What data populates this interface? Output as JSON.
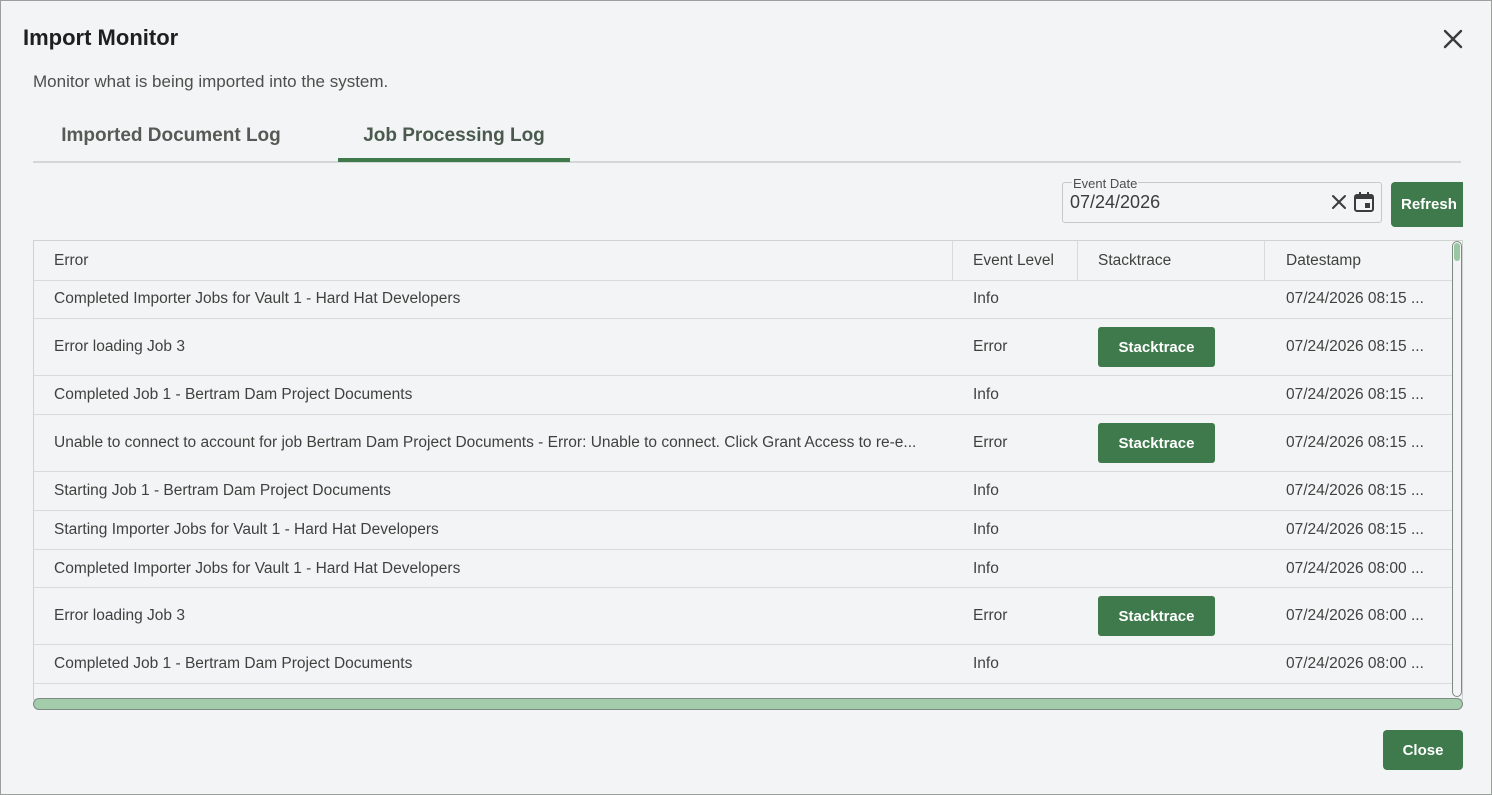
{
  "dialog": {
    "title": "Import Monitor",
    "subtitle": "Monitor what is being imported into the system.",
    "close_icon": "close-icon"
  },
  "tabs": [
    {
      "label": "Imported Document Log",
      "active": false
    },
    {
      "label": "Job Processing Log",
      "active": true
    }
  ],
  "filter": {
    "label": "Event Date",
    "value": "07/24/2026",
    "refresh_label": "Refresh",
    "clear_icon": "clear-icon",
    "calendar_icon": "calendar-icon"
  },
  "grid": {
    "columns": [
      "Error",
      "Event Level",
      "Stacktrace",
      "Datestamp"
    ],
    "stacktrace_label": "Stacktrace",
    "rows": [
      {
        "error": "Completed Importer Jobs for Vault 1 - Hard Hat Developers",
        "level": "Info",
        "stacktrace": false,
        "datestamp": "07/24/2026 08:15 ..."
      },
      {
        "error": "Error loading Job 3",
        "level": "Error",
        "stacktrace": true,
        "datestamp": "07/24/2026 08:15 ..."
      },
      {
        "error": "Completed Job 1 - Bertram Dam Project Documents",
        "level": "Info",
        "stacktrace": false,
        "datestamp": "07/24/2026 08:15 ..."
      },
      {
        "error": "Unable to connect to account for job Bertram Dam Project Documents - Error: Unable to connect. Click Grant Access to re-e...",
        "level": "Error",
        "stacktrace": true,
        "datestamp": "07/24/2026 08:15 ..."
      },
      {
        "error": "Starting Job 1 - Bertram Dam Project Documents",
        "level": "Info",
        "stacktrace": false,
        "datestamp": "07/24/2026 08:15 ..."
      },
      {
        "error": "Starting Importer Jobs for Vault 1 - Hard Hat Developers",
        "level": "Info",
        "stacktrace": false,
        "datestamp": "07/24/2026 08:15 ..."
      },
      {
        "error": "Completed Importer Jobs for Vault 1 - Hard Hat Developers",
        "level": "Info",
        "stacktrace": false,
        "datestamp": "07/24/2026 08:00 ..."
      },
      {
        "error": "Error loading Job 3",
        "level": "Error",
        "stacktrace": true,
        "datestamp": "07/24/2026 08:00 ..."
      },
      {
        "error": "Completed Job 1 - Bertram Dam Project Documents",
        "level": "Info",
        "stacktrace": false,
        "datestamp": "07/24/2026 08:00 ..."
      },
      {
        "error": "",
        "level": "",
        "stacktrace": true,
        "datestamp": ""
      }
    ]
  },
  "footer": {
    "close_label": "Close"
  },
  "colors": {
    "accent": "#3f7a4c",
    "scrollbar": "#a3ccab"
  }
}
